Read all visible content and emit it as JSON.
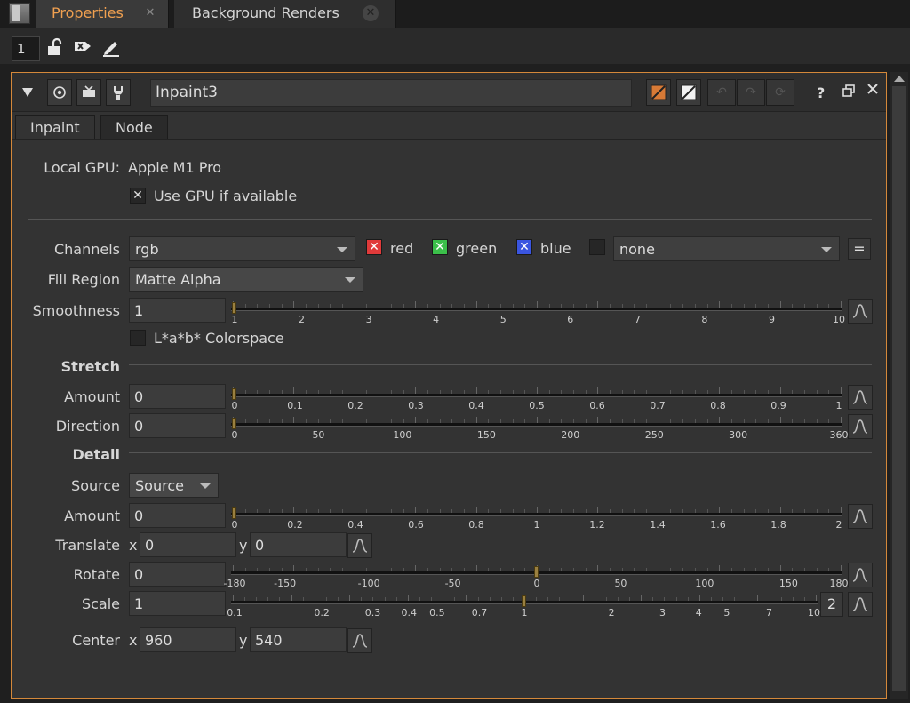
{
  "tabs": {
    "properties": "Properties",
    "background_renders": "Background Renders",
    "close_glyph": "✕"
  },
  "toolbar": {
    "panel_count": "1"
  },
  "node": {
    "name": "Inpaint3",
    "tabs": [
      "Inpaint",
      "Node"
    ],
    "help": "?"
  },
  "gpu": {
    "label": "Local GPU:",
    "value": "Apple M1 Pro",
    "use_gpu_label": "Use GPU if available",
    "use_gpu_checked": true
  },
  "channels": {
    "label": "Channels",
    "value": "rgb",
    "red": "red",
    "green": "green",
    "blue": "blue",
    "extra": "none",
    "eq": "=",
    "colors": {
      "red": "#e03a3a",
      "green": "#3bbf4a",
      "blue": "#3a55e0"
    }
  },
  "fill_region": {
    "label": "Fill Region",
    "value": "Matte Alpha"
  },
  "smoothness": {
    "label": "Smoothness",
    "value": "1",
    "ticks": [
      "1",
      "2",
      "3",
      "4",
      "5",
      "6",
      "7",
      "8",
      "9",
      "10"
    ],
    "level": 1
  },
  "lab": {
    "label": "L*a*b* Colorspace",
    "checked": false
  },
  "stretch": {
    "title": "Stretch",
    "amount": {
      "label": "Amount",
      "value": "0",
      "ticks": [
        "0",
        "0.1",
        "0.2",
        "0.3",
        "0.4",
        "0.5",
        "0.6",
        "0.7",
        "0.8",
        "0.9",
        "1"
      ]
    },
    "direction": {
      "label": "Direction",
      "value": "0",
      "ticks": [
        "0",
        "50",
        "100",
        "150",
        "200",
        "250",
        "300",
        "360"
      ]
    }
  },
  "detail": {
    "title": "Detail",
    "source": {
      "label": "Source",
      "value": "Source"
    },
    "amount": {
      "label": "Amount",
      "value": "0",
      "ticks": [
        "0",
        "0.2",
        "0.4",
        "0.6",
        "0.8",
        "1",
        "1.2",
        "1.4",
        "1.6",
        "1.8",
        "2"
      ]
    },
    "translate": {
      "label": "Translate",
      "x_label": "x",
      "x": "0",
      "y_label": "y",
      "y": "0"
    },
    "rotate": {
      "label": "Rotate",
      "value": "0",
      "ticks": [
        "-180",
        "-150",
        "-100",
        "-50",
        "0",
        "50",
        "100",
        "150",
        "180"
      ]
    },
    "scale": {
      "label": "Scale",
      "value": "1",
      "ticks": [
        "0.1",
        "0.2",
        "0.3",
        "0.4",
        "0.5",
        "0.7",
        "1",
        "2",
        "3",
        "4",
        "5",
        "7",
        "10"
      ],
      "dims": "2"
    },
    "center": {
      "label": "Center",
      "x_label": "x",
      "x": "960",
      "y_label": "y",
      "y": "540"
    }
  }
}
